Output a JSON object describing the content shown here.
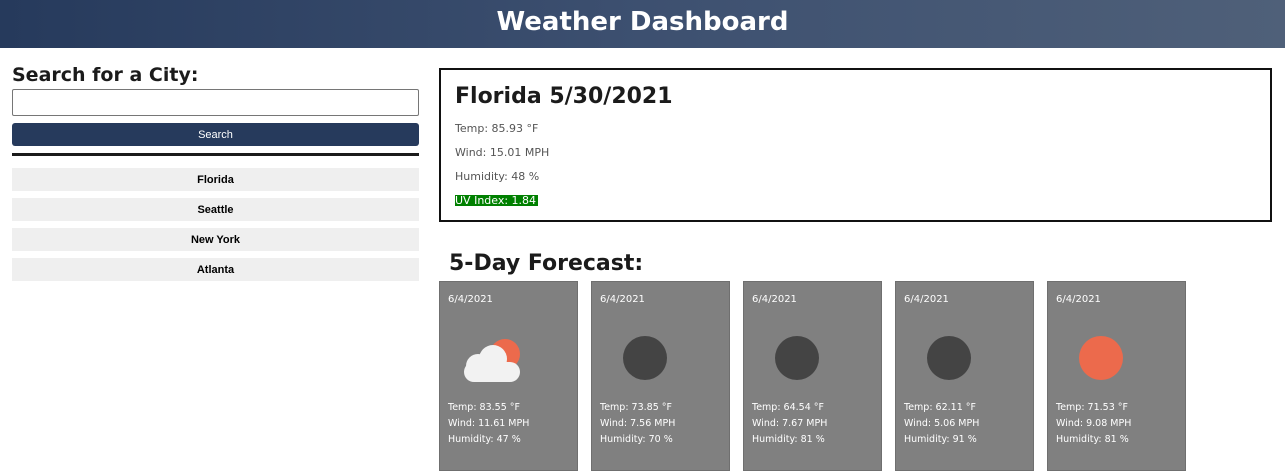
{
  "header": {
    "title": "Weather Dashboard"
  },
  "search": {
    "title": "Search for a City:",
    "input_value": "",
    "input_placeholder": "",
    "button_label": "Search"
  },
  "history": [
    "Florida",
    "Seattle",
    "New York",
    "Atlanta"
  ],
  "current": {
    "title": "Florida 5/30/2021",
    "temp": "Temp: 85.93 °F",
    "wind": "Wind: 15.01 MPH",
    "humidity": "Humidity: 48 %",
    "uv": "UV Index: 1.84",
    "uv_color": "#008000"
  },
  "forecast_title": "5-Day Forecast:",
  "forecast": [
    {
      "date": "6/4/2021",
      "icon": "partly-cloudy-icon",
      "temp": "Temp: 83.55 °F",
      "wind": "Wind: 11.61 MPH",
      "humidity": "Humidity: 47 %"
    },
    {
      "date": "6/4/2021",
      "icon": "moon-icon",
      "temp": "Temp: 73.85 °F",
      "wind": "Wind: 7.56 MPH",
      "humidity": "Humidity: 70 %"
    },
    {
      "date": "6/4/2021",
      "icon": "moon-icon",
      "temp": "Temp: 64.54 °F",
      "wind": "Wind: 7.67 MPH",
      "humidity": "Humidity: 81 %"
    },
    {
      "date": "6/4/2021",
      "icon": "moon-icon",
      "temp": "Temp: 62.11 °F",
      "wind": "Wind: 5.06 MPH",
      "humidity": "Humidity: 91 %"
    },
    {
      "date": "6/4/2021",
      "icon": "sun-icon",
      "temp": "Temp: 71.53 °F",
      "wind": "Wind: 9.08 MPH",
      "humidity": "Humidity: 81 %"
    }
  ],
  "colors": {
    "header": "#263a5c",
    "button": "#263a5c",
    "card": "#808080",
    "sun": "#ec6a4c",
    "moon": "#444444",
    "cloud": "#f2f2f2"
  }
}
